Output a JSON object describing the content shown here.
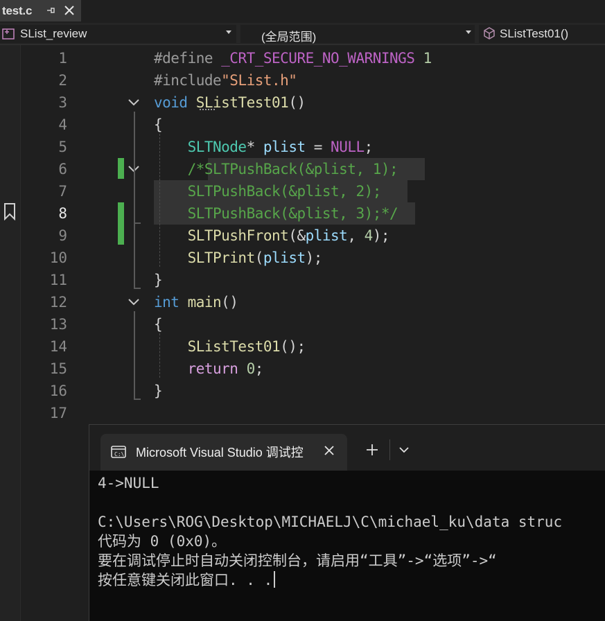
{
  "tab": {
    "filename": "test.c"
  },
  "navbar": {
    "project": "SList_review",
    "scope": "(全局范围)",
    "function": "SListTest01()"
  },
  "editor": {
    "current_line": 8,
    "lines": [
      {
        "number": "1",
        "tokens": [
          {
            "t": "#define ",
            "c": "#9b9b9b"
          },
          {
            "t": "_CRT_SECURE_NO_WARNINGS",
            "c": "#bd63c5"
          },
          {
            "t": " 1",
            "c": "#b5cea8"
          }
        ]
      },
      {
        "number": "2",
        "tokens": [
          {
            "t": "#include",
            "c": "#9b9b9b"
          },
          {
            "t": "\"SList.h\"",
            "c": "#e8a07a"
          }
        ]
      },
      {
        "number": "3",
        "tokens": [
          {
            "t": "void",
            "c": "#569cd6"
          },
          {
            "t": " ",
            "c": "#d4d4d4"
          },
          {
            "t": "SListTest01",
            "c": "#dcdcaa"
          },
          {
            "t": "()",
            "c": "#d4d4d4"
          }
        ]
      },
      {
        "number": "4",
        "tokens": [
          {
            "t": "{",
            "c": "#d4d4d4"
          }
        ]
      },
      {
        "number": "5",
        "tokens": [
          {
            "t": "    ",
            "c": "#d4d4d4"
          },
          {
            "t": "SLTNode",
            "c": "#4ec9b0"
          },
          {
            "t": "* ",
            "c": "#d4d4d4"
          },
          {
            "t": "plist",
            "c": "#9cdcfe"
          },
          {
            "t": " = ",
            "c": "#d4d4d4"
          },
          {
            "t": "NULL",
            "c": "#bd63c5"
          },
          {
            "t": ";",
            "c": "#d4d4d4"
          }
        ]
      },
      {
        "number": "6",
        "tokens": [
          {
            "t": "    ",
            "c": "#d4d4d4"
          },
          {
            "t": "/*SLTPushBack(&plist, 1);",
            "c": "#57a64a"
          }
        ]
      },
      {
        "number": "7",
        "tokens": [
          {
            "t": "    ",
            "c": "#d4d4d4"
          },
          {
            "t": "SLTPushBack(&plist, 2);",
            "c": "#57a64a"
          }
        ]
      },
      {
        "number": "8",
        "tokens": [
          {
            "t": "    ",
            "c": "#d4d4d4"
          },
          {
            "t": "SLTPushBack(&plist, 3);*/",
            "c": "#57a64a"
          }
        ]
      },
      {
        "number": "9",
        "tokens": [
          {
            "t": "    ",
            "c": "#d4d4d4"
          },
          {
            "t": "SLTPushFront",
            "c": "#dcdcaa"
          },
          {
            "t": "(&",
            "c": "#d4d4d4"
          },
          {
            "t": "plist",
            "c": "#9cdcfe"
          },
          {
            "t": ", ",
            "c": "#d4d4d4"
          },
          {
            "t": "4",
            "c": "#b5cea8"
          },
          {
            "t": ");",
            "c": "#d4d4d4"
          }
        ]
      },
      {
        "number": "10",
        "tokens": [
          {
            "t": "    ",
            "c": "#d4d4d4"
          },
          {
            "t": "SLTPrint",
            "c": "#dcdcaa"
          },
          {
            "t": "(",
            "c": "#d4d4d4"
          },
          {
            "t": "plist",
            "c": "#9cdcfe"
          },
          {
            "t": ");",
            "c": "#d4d4d4"
          }
        ]
      },
      {
        "number": "11",
        "tokens": [
          {
            "t": "}",
            "c": "#d4d4d4"
          }
        ]
      },
      {
        "number": "12",
        "tokens": [
          {
            "t": "int",
            "c": "#569cd6"
          },
          {
            "t": " ",
            "c": "#d4d4d4"
          },
          {
            "t": "main",
            "c": "#dcdcaa"
          },
          {
            "t": "()",
            "c": "#d4d4d4"
          }
        ]
      },
      {
        "number": "13",
        "tokens": [
          {
            "t": "{",
            "c": "#d4d4d4"
          }
        ]
      },
      {
        "number": "14",
        "tokens": [
          {
            "t": "    ",
            "c": "#d4d4d4"
          },
          {
            "t": "SListTest01",
            "c": "#dcdcaa"
          },
          {
            "t": "();",
            "c": "#d4d4d4"
          }
        ]
      },
      {
        "number": "15",
        "tokens": [
          {
            "t": "    ",
            "c": "#d4d4d4"
          },
          {
            "t": "return",
            "c": "#d8a0df"
          },
          {
            "t": " ",
            "c": "#d4d4d4"
          },
          {
            "t": "0",
            "c": "#b5cea8"
          },
          {
            "t": ";",
            "c": "#d4d4d4"
          }
        ]
      },
      {
        "number": "16",
        "tokens": [
          {
            "t": "}",
            "c": "#d4d4d4"
          }
        ]
      },
      {
        "number": "17",
        "tokens": []
      }
    ]
  },
  "console": {
    "tab_title": "Microsoft Visual Studio 调试控",
    "output_lines": [
      "4->NULL",
      "",
      "C:\\Users\\ROG\\Desktop\\MICHAELJ\\C\\michael_ku\\data struc",
      "代码为 0 (0x0)。",
      "要在调试停止时自动关闭控制台，请启用“工具”->“选项”->“",
      "按任意键关闭此窗口. . ."
    ]
  },
  "colors": {
    "change_bar": "#4caf50",
    "comment": "#57a64a",
    "keyword": "#569cd6",
    "function": "#dcdcaa",
    "type": "#4ec9b0",
    "variable": "#9cdcfe",
    "macro": "#bd63c5",
    "number": "#b5cea8",
    "string": "#e8a07a",
    "control_keyword": "#d8a0df"
  }
}
